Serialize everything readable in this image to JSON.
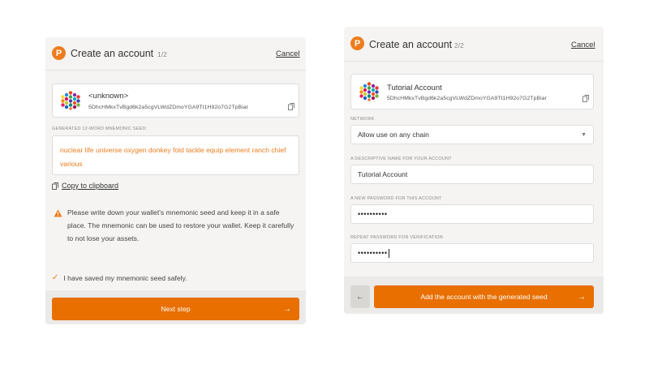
{
  "accent_color": "#ef7c1c",
  "step1": {
    "header": {
      "title": "Create an account",
      "step": "1/2",
      "cancel": "Cancel"
    },
    "account": {
      "name": "<unknown>",
      "address": "5DhcHMkxTvBgd6k2a5cgVLWdZDmoYGA9Tt1H92o7G2TpBiar"
    },
    "seed": {
      "label": "GENERATED 12-WORD MNEMONIC SEED:",
      "text": "nuclear life universe oxygen donkey fold tackle equip element ranch chief various"
    },
    "copy_label": "Copy to clipboard",
    "warning": "Please write down your wallet's mnemonic seed and keep it in a safe place. The mnemonic can be used to restore your wallet. Keep it carefully to not lose your assets.",
    "checkbox_label": "I have saved my mnemonic seed safely.",
    "next_button": "Next step"
  },
  "step2": {
    "header": {
      "title": "Create an account",
      "step": "2/2",
      "cancel": "Cancel"
    },
    "account": {
      "name": "Tutorial Account",
      "address": "5DhcHMkxTvBgd6k2a5cgVLWdZDmoYGA9Tt1H92o7G2TpBiar"
    },
    "network": {
      "label": "NETWORK",
      "value": "Allow use on any chain"
    },
    "name_field": {
      "label": "A DESCRIPTIVE NAME FOR YOUR ACCOUNT",
      "value": "Tutorial Account"
    },
    "password_field": {
      "label": "A NEW PASSWORD FOR THIS ACCOUNT",
      "value": "••••••••••"
    },
    "repeat_field": {
      "label": "REPEAT PASSWORD FOR VERIFICATION",
      "value": "••••••••••"
    },
    "add_button": "Add the account with the generated seed"
  }
}
